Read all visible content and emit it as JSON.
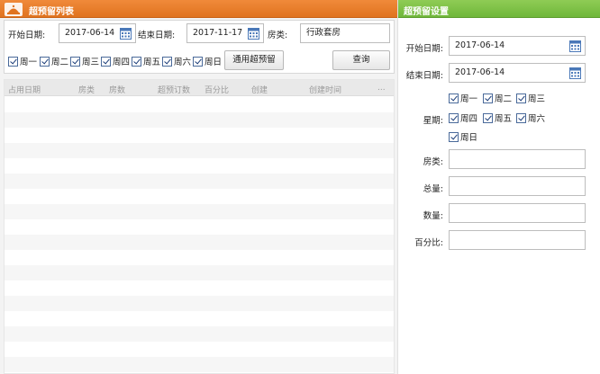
{
  "left_panel": {
    "title": "超预留列表",
    "start_date_label": "开始日期:",
    "start_date": "2017-06-14",
    "end_date_label": "结束日期:",
    "end_date": "2017-11-17",
    "room_type_label": "房类:",
    "room_type": "行政套房",
    "weekdays": [
      "周一",
      "周二",
      "周三",
      "周四",
      "周五",
      "周六",
      "周日"
    ],
    "universal_button": "通用超预留",
    "query_button": "查询",
    "columns": [
      "占用日期",
      "房类",
      "房数",
      "超预订数",
      "百分比",
      "创建",
      "创建时间",
      "..."
    ]
  },
  "right_panel": {
    "title": "超预留设置",
    "start_date_label": "开始日期:",
    "start_date": "2017-06-14",
    "end_date_label": "结束日期:",
    "end_date": "2017-06-14",
    "week_label": "星期:",
    "weekdays": [
      "周一",
      "周二",
      "周三",
      "周四",
      "周五",
      "周六",
      "周日"
    ],
    "room_type_label": "房类:",
    "total_label": "总量:",
    "quantity_label": "数量:",
    "percent_label": "百分比:",
    "room_type": "",
    "total": "",
    "quantity": "",
    "percent": ""
  },
  "colors": {
    "orange_header": "#e0731f",
    "green_header": "#6fb73a"
  },
  "icons": {
    "header": "hotel-bell-icon",
    "date_picker": "calendar-icon",
    "checkbox": "checkmark-icon"
  }
}
